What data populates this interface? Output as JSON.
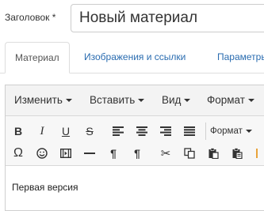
{
  "form": {
    "title_label": "Заголовок *",
    "title_value": "Новый материал"
  },
  "tabs": [
    {
      "label": "Материал",
      "active": true
    },
    {
      "label": "Изображения и ссылки",
      "active": false
    },
    {
      "label": "Параметры",
      "active": false
    }
  ],
  "editor": {
    "menu": [
      {
        "label": "Изменить"
      },
      {
        "label": "Вставить"
      },
      {
        "label": "Вид"
      },
      {
        "label": "Формат"
      }
    ],
    "format_dropdown": "Формат",
    "toolbar_row1": [
      "bold-icon",
      "italic-icon",
      "underline-icon",
      "strikethrough-icon",
      "align-left-icon",
      "align-center-icon",
      "align-right-icon",
      "align-justify-icon"
    ],
    "toolbar_row2": [
      "omega-icon",
      "emoticon-icon",
      "media-icon",
      "horizontal-rule-icon",
      "paragraph-ltr-icon",
      "paragraph-rtl-icon",
      "cut-icon",
      "copy-icon",
      "paste-icon",
      "paste-text-icon"
    ],
    "content": "Первая версия"
  },
  "colors": {
    "link": "#2a6cb0",
    "menubar_bg": "#f3f3f3",
    "toolbar_bg": "#f7f7f7",
    "border": "#cfcfcf"
  }
}
